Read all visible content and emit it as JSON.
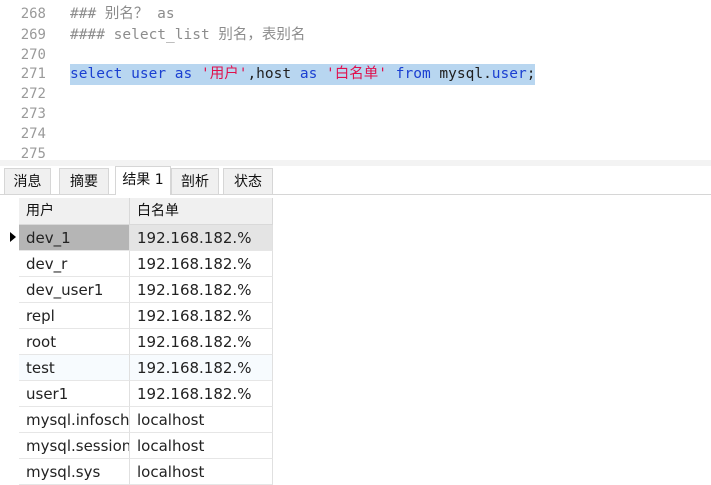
{
  "editor": {
    "lines": [
      {
        "num": "268",
        "text": "### 别名？ as"
      },
      {
        "num": "269",
        "text": "#### select_list 别名，表别名"
      },
      {
        "num": "270",
        "text": ""
      },
      {
        "num": "271",
        "text": ""
      },
      {
        "num": "272",
        "text": ""
      },
      {
        "num": "273",
        "text": ""
      },
      {
        "num": "274",
        "text": ""
      },
      {
        "num": "275",
        "text": ""
      }
    ],
    "query": {
      "kw_select": "select",
      "col_user": "user",
      "kw_as1": "as",
      "alias_user": "'用户'",
      "comma_host": ",host",
      "kw_as2": "as",
      "alias_host": "'白名单'",
      "kw_from": "from",
      "table_db": "mysql",
      "dot": ".",
      "table_name": "user",
      "semicolon": ";"
    }
  },
  "tabs": [
    {
      "label": "消息"
    },
    {
      "label": "摘要"
    },
    {
      "label": "结果 1"
    },
    {
      "label": "剖析"
    },
    {
      "label": "状态"
    }
  ],
  "active_tab": "结果 1",
  "results": {
    "columns": [
      "用户",
      "白名单"
    ],
    "rows": [
      [
        "dev_1",
        "192.168.182.%"
      ],
      [
        "dev_r",
        "192.168.182.%"
      ],
      [
        "dev_user1",
        "192.168.182.%"
      ],
      [
        "repl",
        "192.168.182.%"
      ],
      [
        "root",
        "192.168.182.%"
      ],
      [
        "test",
        "192.168.182.%"
      ],
      [
        "user1",
        "192.168.182.%"
      ],
      [
        "mysql.infosch",
        "localhost"
      ],
      [
        "mysql.session",
        "localhost"
      ],
      [
        "mysql.sys",
        "localhost"
      ]
    ]
  }
}
